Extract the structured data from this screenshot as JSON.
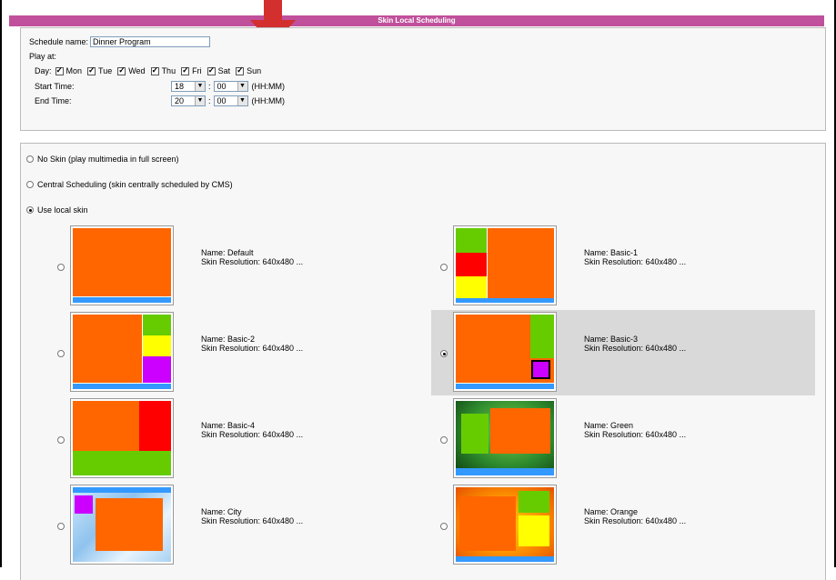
{
  "header": {
    "title": "Skin Local Scheduling"
  },
  "schedule": {
    "name_label": "Schedule name:",
    "name_value": "Dinner Program",
    "play_at_label": "Play at:",
    "day_label": "Day:",
    "days": [
      "Mon",
      "Tue",
      "Wed",
      "Thu",
      "Fri",
      "Sat",
      "Sun"
    ],
    "start_label": "Start Time:",
    "end_label": "End Time:",
    "start_hour": "18",
    "start_min": "00",
    "end_hour": "20",
    "end_min": "00",
    "sep": ":",
    "format": "(HH:MM)"
  },
  "options": {
    "no_skin": "No Skin (play multimedia in full screen)",
    "central": "Central Scheduling (skin centrally scheduled by CMS)",
    "local": "Use local skin"
  },
  "skins": [
    {
      "name": "Name: Default",
      "res": "Skin Resolution: 640x480 ..."
    },
    {
      "name": "Name: Basic-1",
      "res": "Skin Resolution: 640x480 ..."
    },
    {
      "name": "Name: Basic-2",
      "res": "Skin Resolution: 640x480 ..."
    },
    {
      "name": "Name: Basic-3",
      "res": "Skin Resolution: 640x480 ..."
    },
    {
      "name": "Name: Basic-4",
      "res": "Skin Resolution: 640x480 ..."
    },
    {
      "name": "Name: Green",
      "res": "Skin Resolution: 640x480 ..."
    },
    {
      "name": "Name: City",
      "res": "Skin Resolution: 640x480 ..."
    },
    {
      "name": "Name: Orange",
      "res": "Skin Resolution: 640x480 ..."
    }
  ],
  "colors": {
    "header": "#c0509b",
    "arrow": "#d32f2f",
    "orange": "#ff6600",
    "green": "#66cc00",
    "yellow": "#ffff00",
    "red": "#ff0000",
    "purple": "#cc00ff",
    "blue": "#3399ff"
  }
}
